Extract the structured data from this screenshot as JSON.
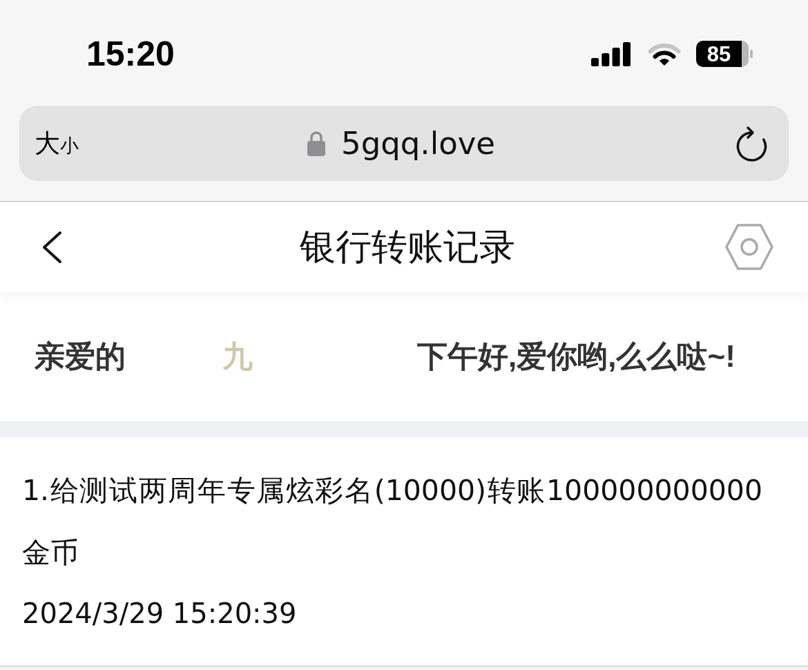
{
  "status_bar": {
    "time": "15:20",
    "battery": "85"
  },
  "address_bar": {
    "text_size_button": {
      "large": "大",
      "small": "小"
    },
    "url": "5gqq.love"
  },
  "header": {
    "title": "银行转账记录"
  },
  "greeting": {
    "salutation": "亲爱的",
    "name": "九",
    "message": "下午好,爱你哟,么么哒~!"
  },
  "records": [
    {
      "text": "1.给测试两周年专属炫彩名(10000)转账100000000000金币",
      "time": "2024/3/29 15:20:39"
    }
  ]
}
